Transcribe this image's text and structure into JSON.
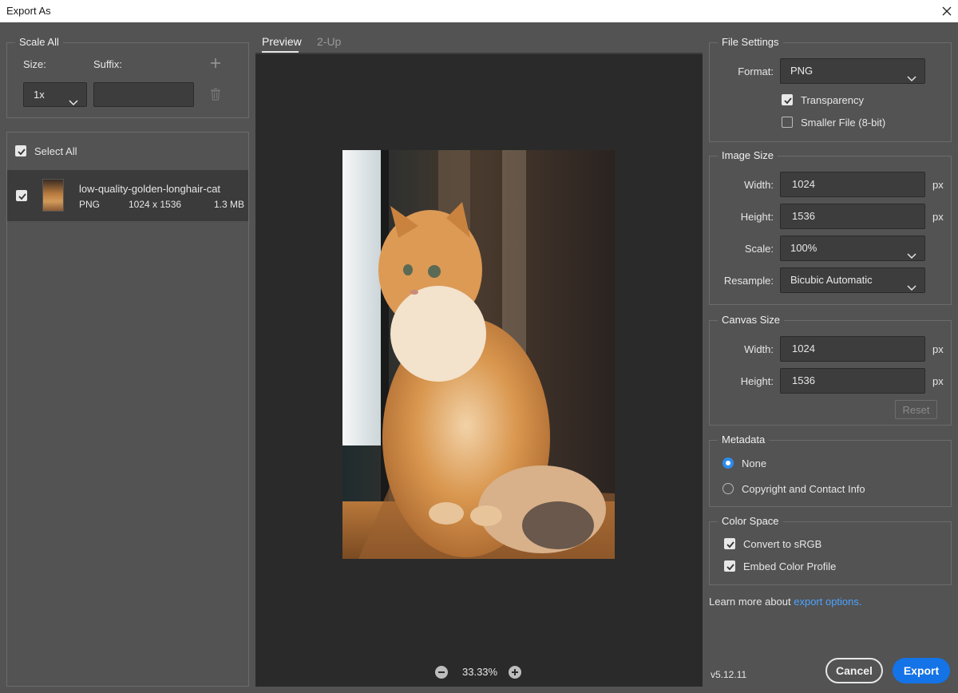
{
  "window": {
    "title": "Export As"
  },
  "scale_all": {
    "legend": "Scale All",
    "size_label": "Size:",
    "suffix_label": "Suffix:",
    "size_value": "1x",
    "suffix_value": ""
  },
  "assets": {
    "select_all_label": "Select All",
    "items": [
      {
        "name": "low-quality-golden-longhair-cat",
        "format": "PNG",
        "dimensions": "1024 x 1536",
        "size": "1.3 MB"
      }
    ]
  },
  "tabs": [
    "Preview",
    "2-Up"
  ],
  "preview": {
    "zoom": "33.33%"
  },
  "file_settings": {
    "legend": "File Settings",
    "format_label": "Format:",
    "format_value": "PNG",
    "transparency_label": "Transparency",
    "smaller_file_label": "Smaller File (8-bit)"
  },
  "image_size": {
    "legend": "Image Size",
    "width_label": "Width:",
    "width_value": "1024",
    "height_label": "Height:",
    "height_value": "1536",
    "scale_label": "Scale:",
    "scale_value": "100%",
    "resample_label": "Resample:",
    "resample_value": "Bicubic Automatic",
    "unit": "px"
  },
  "canvas_size": {
    "legend": "Canvas Size",
    "width_label": "Width:",
    "width_value": "1024",
    "height_label": "Height:",
    "height_value": "1536",
    "unit": "px",
    "reset_label": "Reset"
  },
  "metadata": {
    "legend": "Metadata",
    "options": [
      "None",
      "Copyright and Contact Info"
    ]
  },
  "color_space": {
    "legend": "Color Space",
    "convert_label": "Convert to sRGB",
    "embed_label": "Embed Color Profile"
  },
  "learn_more": {
    "text": "Learn more about ",
    "link": "export options."
  },
  "footer": {
    "version": "v5.12.11",
    "cancel_label": "Cancel",
    "export_label": "Export"
  },
  "colors": {
    "accent": "#1473e6",
    "link": "#4da3ff",
    "radio": "#2d8ceb",
    "panel": "#535353",
    "preview_bg": "#2a2a2a"
  }
}
